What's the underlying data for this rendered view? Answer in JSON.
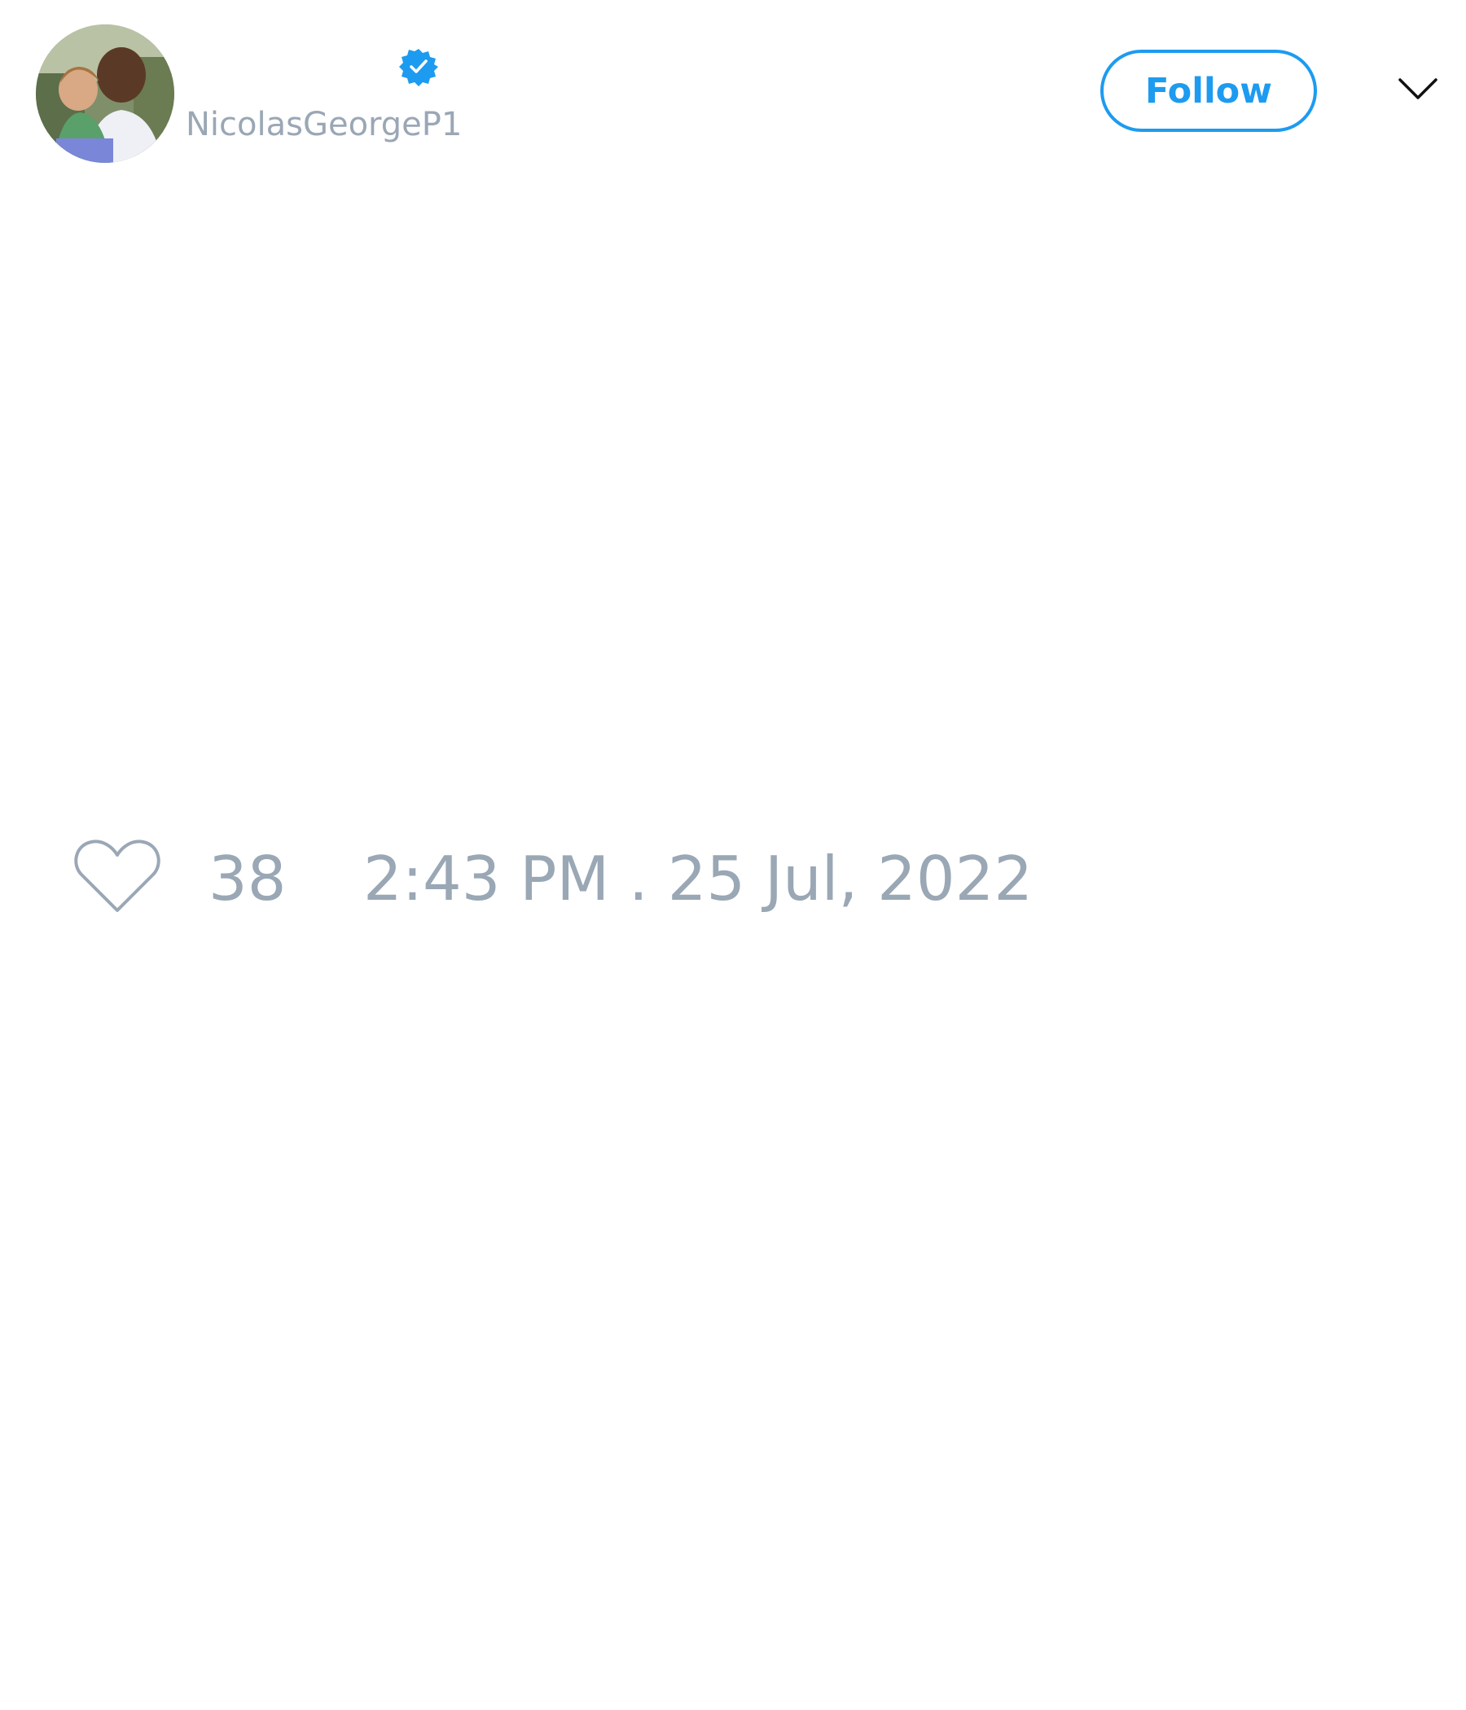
{
  "author": {
    "handle": "NicolasGeorgeP1",
    "verified": true
  },
  "header": {
    "follow_label": "Follow",
    "menu_icon": "chevron-down-icon"
  },
  "tweet": {
    "like_count": "38",
    "timestamp": "2:43 PM . 25 Jul, 2022"
  },
  "colors": {
    "accent": "#1d9bf0",
    "muted_text": "#9aa7b5",
    "background": "#ffffff"
  },
  "icons": {
    "verified": "verified-badge-icon",
    "like": "heart-icon"
  }
}
